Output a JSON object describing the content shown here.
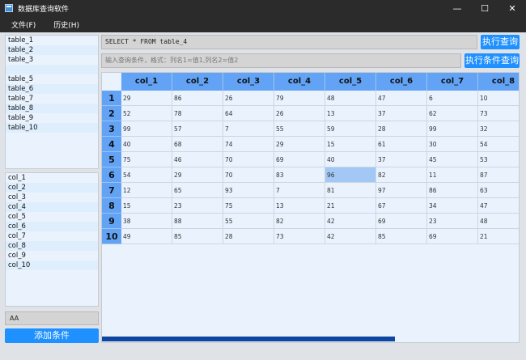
{
  "window": {
    "title": "数据库查询软件",
    "controls": {
      "minimize": "—",
      "maximize": "☐",
      "close": "✕"
    }
  },
  "menu": [
    {
      "label": "文件(F)"
    },
    {
      "label": "历史(H)"
    }
  ],
  "tables_list": [
    "table_1",
    "table_2",
    "table_3",
    "",
    "table_5",
    "table_6",
    "table_7",
    "table_8",
    "table_9",
    "table_10"
  ],
  "columns_list": [
    "col_1",
    "col_2",
    "col_3",
    "col_4",
    "col_5",
    "col_6",
    "col_7",
    "col_8",
    "col_9",
    "col_10"
  ],
  "condition": {
    "value": "AA",
    "add_button": "添加条件"
  },
  "query": {
    "sql": "SELECT * FROM table_4",
    "run_button": "执行查询",
    "where_placeholder": "输入查询条件，格式：列名1=值1,列名2=值2",
    "run_condition_button": "执行条件查询"
  },
  "grid": {
    "headers": [
      "col_1",
      "col_2",
      "col_3",
      "col_4",
      "col_5",
      "col_6",
      "col_7",
      "col_8"
    ],
    "row_labels": [
      "1",
      "2",
      "3",
      "4",
      "5",
      "6",
      "7",
      "8",
      "9",
      "10"
    ],
    "rows": [
      [
        "29",
        "86",
        "26",
        "79",
        "48",
        "47",
        "6",
        "10"
      ],
      [
        "52",
        "78",
        "64",
        "26",
        "13",
        "37",
        "62",
        "73"
      ],
      [
        "99",
        "57",
        "7",
        "55",
        "59",
        "28",
        "99",
        "32"
      ],
      [
        "40",
        "68",
        "74",
        "29",
        "15",
        "61",
        "30",
        "54"
      ],
      [
        "75",
        "46",
        "70",
        "69",
        "40",
        "37",
        "45",
        "53"
      ],
      [
        "54",
        "29",
        "70",
        "83",
        "96",
        "82",
        "11",
        "87"
      ],
      [
        "12",
        "65",
        "93",
        "7",
        "81",
        "97",
        "86",
        "63"
      ],
      [
        "15",
        "23",
        "75",
        "13",
        "21",
        "67",
        "34",
        "47"
      ],
      [
        "38",
        "88",
        "55",
        "82",
        "42",
        "69",
        "23",
        "48"
      ],
      [
        "49",
        "85",
        "28",
        "73",
        "42",
        "85",
        "69",
        "21"
      ]
    ],
    "selected_cell": {
      "row": 6,
      "column": "col_5"
    }
  },
  "colors": {
    "accent": "#1e90ff",
    "header": "#62a3f5",
    "panel": "#eaf3fd",
    "selected": "#a3c8f5",
    "scroll_thumb": "#0d47a1"
  }
}
